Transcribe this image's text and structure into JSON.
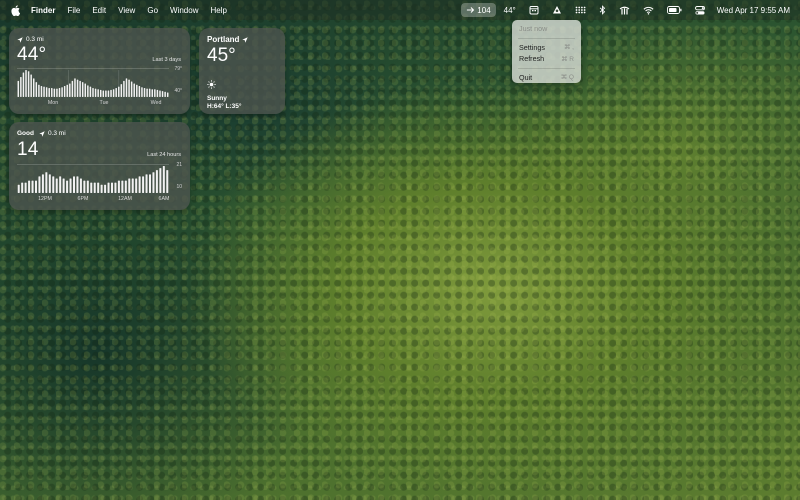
{
  "menubar": {
    "app_name": "Finder",
    "menus": [
      "File",
      "Edit",
      "View",
      "Go",
      "Window",
      "Help"
    ],
    "status": {
      "aqi_value": "104",
      "temperature": "44°"
    },
    "clock": "Wed Apr 17  9:55 AM"
  },
  "dropdown": {
    "updated_label": "Just now",
    "items": [
      {
        "label": "Settings",
        "shortcut": "⌘ ,"
      },
      {
        "label": "Refresh",
        "shortcut": "⌘ R"
      },
      {
        "label": "Quit",
        "shortcut": "⌘ Q"
      }
    ]
  },
  "widgets": {
    "trend": {
      "distance": "0.3 mi",
      "temperature": "44°",
      "range_label": "Last 3 days",
      "scale_max": "79°",
      "scale_min": "40°",
      "days": [
        "Mon",
        "Tue",
        "Wed"
      ],
      "bar_values": [
        62,
        68,
        75,
        79,
        77,
        72,
        66,
        60,
        56,
        54,
        53,
        52,
        51,
        51,
        50,
        50,
        51,
        52,
        54,
        56,
        58,
        62,
        66,
        64,
        62,
        60,
        58,
        55,
        53,
        51,
        50,
        49,
        48,
        47,
        47,
        47,
        48,
        49,
        51,
        53,
        57,
        62,
        66,
        64,
        61,
        58,
        56,
        54,
        52,
        51,
        50,
        50,
        49,
        49,
        48,
        47,
        46,
        45,
        44
      ]
    },
    "current": {
      "city": "Portland",
      "temperature": "45°",
      "condition": "Sunny",
      "hilo": "H:64° L:35°",
      "icon": "sun-icon"
    },
    "aqi": {
      "status": "Good",
      "distance": "0.3 mi",
      "value": "14",
      "range_label": "Last 24 hours",
      "scale_max": "21",
      "scale_min": "10",
      "hours": [
        "12PM",
        "6PM",
        "12AM",
        "6AM"
      ],
      "bar_values": [
        13,
        14,
        14,
        15,
        15,
        15,
        17,
        18,
        19,
        18,
        17,
        16,
        17,
        16,
        15,
        16,
        17,
        17,
        16,
        15,
        15,
        14,
        14,
        14,
        13,
        13,
        14,
        14,
        14,
        15,
        15,
        15,
        16,
        16,
        16,
        17,
        17,
        18,
        18,
        19,
        20,
        21,
        22,
        20
      ]
    }
  },
  "colors": {
    "widget_bg": "#4e5450",
    "menu_bg": "#d7dcd4",
    "bar_color": "#f2f2f2"
  }
}
